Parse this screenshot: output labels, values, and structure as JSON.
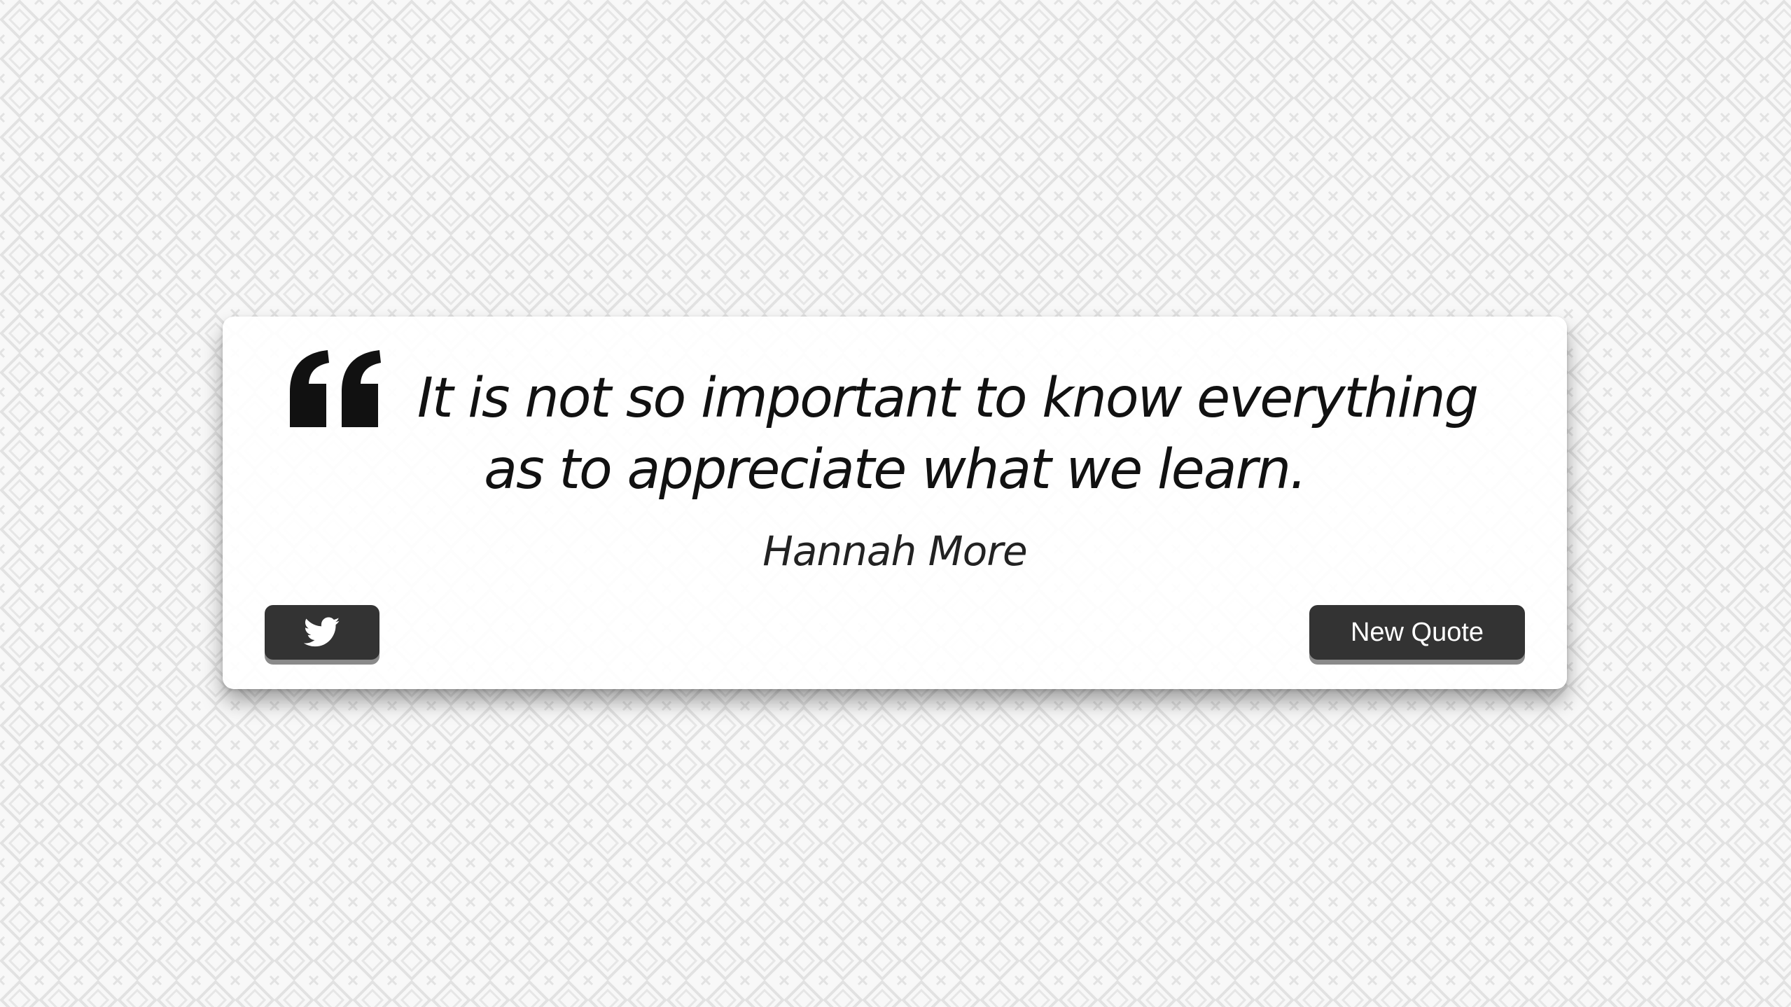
{
  "quote": {
    "text": "It is not so important to know everything as to appreciate what we learn.",
    "author": "Hannah More"
  },
  "actions": {
    "tweet_icon": "twitter-icon",
    "new_quote_label": "New Quote"
  },
  "colors": {
    "button_bg": "#333333",
    "button_text": "#ffffff",
    "card_bg": "#ffffff",
    "page_pattern": "#e4e4e4"
  }
}
